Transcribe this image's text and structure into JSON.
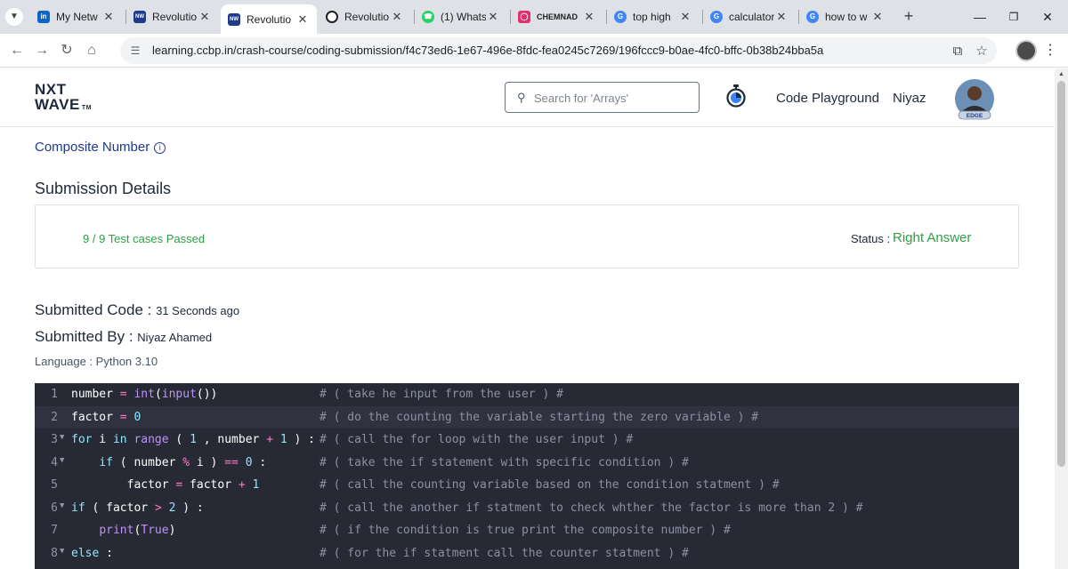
{
  "browser": {
    "tabs": [
      {
        "title": "My Netw",
        "favicon": "linkedin-icon",
        "color": "#0a66c2"
      },
      {
        "title": "Revolutio",
        "favicon": "nxtwave-icon",
        "color": "#1e3a8a"
      },
      {
        "title": "Revolutio",
        "favicon": "nxtwave-icon",
        "color": "#1e3a8a"
      },
      {
        "title": "Revolutio",
        "favicon": "chatgpt-icon",
        "color": "#202124"
      },
      {
        "title": "(1) Whats",
        "favicon": "whatsapp-icon",
        "color": "#25d366"
      },
      {
        "title": "CHEMNAD",
        "favicon": "instagram-icon",
        "color": "#e1306c"
      },
      {
        "title": "top high",
        "favicon": "google-icon",
        "color": "#4285f4"
      },
      {
        "title": "calculator",
        "favicon": "google-icon",
        "color": "#4285f4"
      },
      {
        "title": "how to w",
        "favicon": "google-icon",
        "color": "#4285f4"
      }
    ],
    "active_tab": 2,
    "url": "learning.ccbp.in/crash-course/coding-submission/f4c73ed6-1e67-496e-8fdc-fea0245c7269/196fccc9-b0ae-4fc0-bffc-0b38b24bba5a"
  },
  "header": {
    "logo_line1": "NXT",
    "logo_line2": "WAVE",
    "logo_tm": "TM",
    "search_placeholder": "Search for 'Arrays'",
    "code_playground": "Code Playground",
    "user_name": "Niyaz",
    "avatar_badge": "EDGE"
  },
  "problem": {
    "title": "Composite Number"
  },
  "submission": {
    "heading": "Submission Details",
    "tests_passed": "9 / 9 Test cases Passed",
    "status_label": "Status :",
    "status_value": "Right Answer",
    "submitted_code_label": "Submitted Code :",
    "submitted_code_value": "31 Seconds ago",
    "submitted_by_label": "Submitted By :",
    "submitted_by_value": "Niyaz Ahamed",
    "language": "Language : Python 3.10"
  },
  "code_lines": [
    {
      "n": "1",
      "fold": false,
      "comment": "# ( take he input from the user ) #"
    },
    {
      "n": "2",
      "fold": false,
      "comment": "# ( do the counting the variable starting the zero variable ) #"
    },
    {
      "n": "3",
      "fold": true,
      "comment": "# ( call the for loop with the user input ) #"
    },
    {
      "n": "4",
      "fold": true,
      "comment": "# ( take the if statement with specific condition ) #"
    },
    {
      "n": "5",
      "fold": false,
      "comment": "# ( call the counting variable based on the condition statment ) #"
    },
    {
      "n": "6",
      "fold": true,
      "comment": "# ( call the another if statment to check whther the factor is more than 2 ) #"
    },
    {
      "n": "7",
      "fold": false,
      "comment": "# ( if the condition is true print the composite number ) #"
    },
    {
      "n": "8",
      "fold": true,
      "comment": "# ( for the if statment call the counter statment ) #"
    }
  ],
  "colors": {
    "accent_green": "#2f9e44",
    "link_blue": "#1e3a8a",
    "editor_bg": "#272935"
  }
}
